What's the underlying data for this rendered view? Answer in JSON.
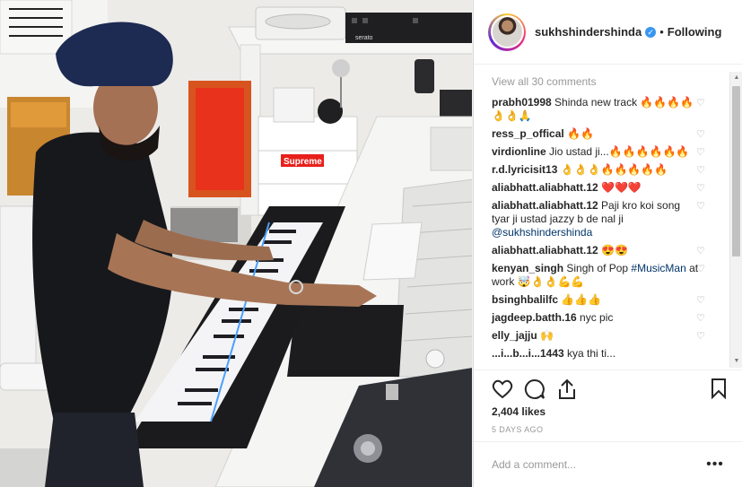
{
  "post": {
    "username": "sukhshindershinda",
    "verified_icon": "verified-badge-icon",
    "separator": "•",
    "follow_state": "Following",
    "view_all": "View all 30 comments",
    "likes": "2,404 likes",
    "time": "5 DAYS AGO",
    "comment_placeholder": "Add a comment...",
    "more_label": "•••",
    "photo_text": {
      "brand_label": "Supreme",
      "device_label": "serato"
    }
  },
  "comments": [
    {
      "user": "prabh01998",
      "text": " Shinda new track 🔥🔥🔥🔥👌👌🙏",
      "mention": ""
    },
    {
      "user": "ress_p_offical",
      "text": " 🔥🔥",
      "mention": ""
    },
    {
      "user": "virdionline",
      "text": " Jio ustad ji...🔥🔥🔥🔥🔥🔥",
      "mention": ""
    },
    {
      "user": "r.d.lyricisit13",
      "text": " 👌👌👌🔥🔥🔥🔥🔥",
      "mention": ""
    },
    {
      "user": "aliabhatt.aliabhatt.12",
      "text": " ❤️❤️❤️",
      "mention": ""
    },
    {
      "user": "aliabhatt.aliabhatt.12",
      "text": " Paji kro koi song tyar ji ustad jazzy b de nal ji ",
      "mention": "@sukhshindershinda"
    },
    {
      "user": "aliabhatt.aliabhatt.12",
      "text": " 😍😍",
      "mention": ""
    },
    {
      "user": "kenyan_singh",
      "text": " Singh of Pop ",
      "mention": "#MusicMan",
      "after": " at work 🤯👌👌💪💪"
    },
    {
      "user": "bsinghbalilfc",
      "text": " 👍👍👍",
      "mention": ""
    },
    {
      "user": "jagdeep.batth.16",
      "text": " nyc pic",
      "mention": ""
    },
    {
      "user": "elly_jajju",
      "text": " 🙌",
      "mention": ""
    },
    {
      "user": "...i...b...i...1443",
      "text": " kya thi ti...",
      "mention": ""
    }
  ],
  "colors": {
    "link": "#003569",
    "muted": "#999999",
    "verified": "#3897f0"
  }
}
